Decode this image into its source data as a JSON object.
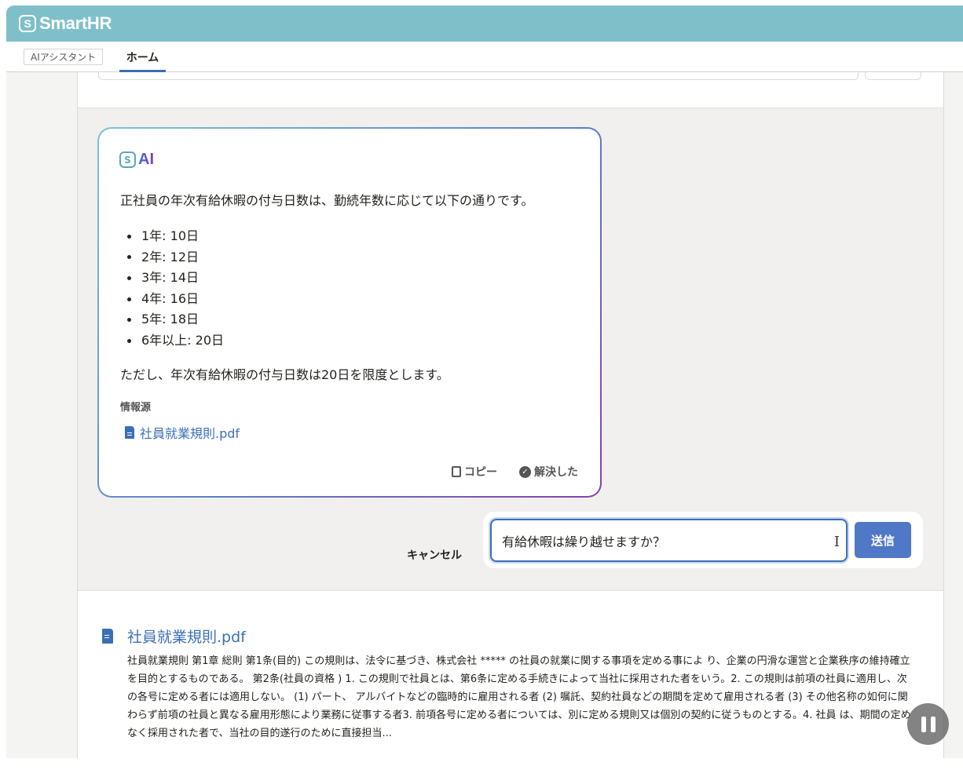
{
  "app": {
    "brand": "SmartHR",
    "logo_glyph": "S"
  },
  "tabs": [
    {
      "label": "AIアシスタント"
    },
    {
      "label": "ホーム",
      "active": true
    }
  ],
  "ai_message": {
    "badge": "AI",
    "intro": "正社員の年次有給休暇の付与日数は、勤続年数に応じて以下の通りです。",
    "items": [
      "1年: 10日",
      "2年: 12日",
      "3年: 14日",
      "4年: 16日",
      "5年: 18日",
      "6年以上: 20日"
    ],
    "note": "ただし、年次有給休暇の付与日数は20日を限度とします。",
    "source_label": "情報源",
    "source_file": "社員就業規則.pdf",
    "copy_label": "コピー",
    "resolved_label": "解決した"
  },
  "composer": {
    "cancel_label": "キャンセル",
    "input_value": "有給休暇は繰り越せますか？",
    "send_label": "送信"
  },
  "document": {
    "title": "社員就業規則.pdf",
    "body": "社員就業規則 第1章 総則 第1条(目的) この規則は、法令に基づき、株式会社 ***** の社員の就業に関する事項を定める事によ り、企業の円滑な運営と企業秩序の維持確立を目的とするものである。 第2条(社員の資格 ) 1. この規則で社員とは、第6条に定める手続きによって当社に採用された者をいう。2. この規則は前項の社員に適用し、次の各号に定める者には適用しない。 (1) パート、 アルバイトなどの臨時的に雇用される者 (2) 嘱託、契約社員などの期間を定めて雇用される者 (3) その他名称の如何に関わらず前項の社員と異なる雇用形態により業務に従事する者3. 前項各号に定める者については、別に定める規則又は個別の契約に従うものとする。4. 社員 は、期間の定めなく採用された者で、当社の目的遂行のために直接担当..."
  },
  "colors": {
    "topbar": "#7fbfc9",
    "accent": "#3b6fb6",
    "send": "#4f78c7"
  }
}
